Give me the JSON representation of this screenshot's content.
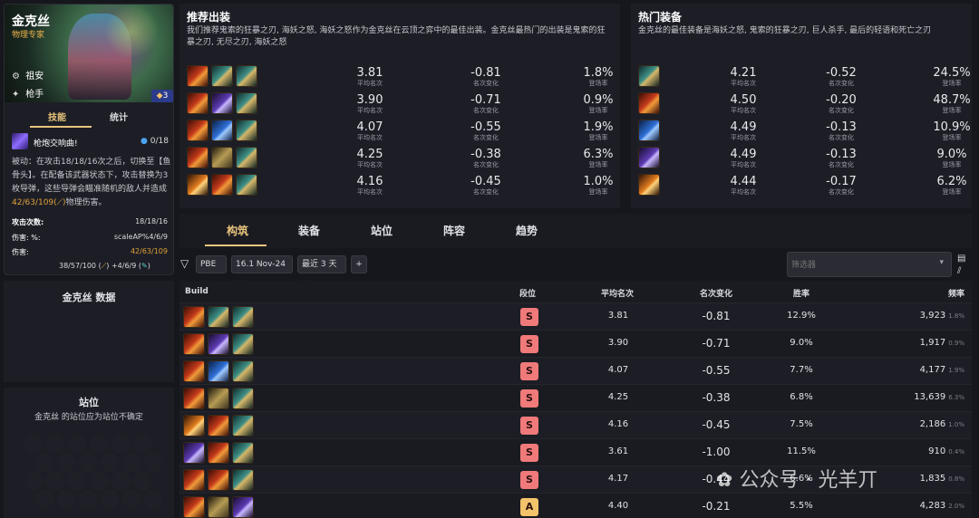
{
  "champion": {
    "name": "金克丝",
    "role": "物理专家",
    "traits": [
      {
        "icon": "rebel-icon",
        "label": "祖安"
      },
      {
        "icon": "sniper-icon",
        "label": "枪手"
      }
    ],
    "cost_badge": "3",
    "tabs": [
      "技能",
      "统计"
    ],
    "ability_name": "枪炮交响曲!",
    "mana": "0/18",
    "desc_1": "被动：在攻击18/18/16次之后，切换至【鱼骨头】。在配备该武器状态下，攻击替换为3枚导弹，这些导弹会瞄准随机的敌人并造成",
    "desc_dmg": "42/63/109",
    "desc_2": "物理伤害。",
    "stats": [
      {
        "label": "攻击次数:",
        "value": "18/18/16"
      },
      {
        "label": "伤害: %:",
        "value": "scaleAP%4/6/9"
      },
      {
        "label": "伤害:",
        "value": "42/63/109"
      }
    ],
    "footer_stat_a": "38/57/100 (",
    "footer_stat_b": ") +4/6/9 (",
    "footer_stat_c": ")"
  },
  "data_section": {
    "title": "金克丝 数据"
  },
  "position_section": {
    "title": "站位",
    "desc": "金克丝 的站位应为站位不确定"
  },
  "recommended": {
    "title": "推荐出装",
    "desc": "我们推荐鬼索的狂暴之刃, 海妖之怒, 海妖之怒作为金克丝在云顶之弈中的最佳出装。金克丝最热门的出装是鬼索的狂暴之刃, 无尽之刃, 海妖之怒",
    "rows": [
      {
        "items": [
          "fire",
          "dagger",
          "dagger"
        ],
        "avg": "3.81",
        "change": "-0.81",
        "rate": "1.8%"
      },
      {
        "items": [
          "fire",
          "violet",
          "dagger"
        ],
        "avg": "3.90",
        "change": "-0.71",
        "rate": "0.9%"
      },
      {
        "items": [
          "fire",
          "wave",
          "dagger"
        ],
        "avg": "4.07",
        "change": "-0.55",
        "rate": "1.9%"
      },
      {
        "items": [
          "fire",
          "claw",
          "dagger"
        ],
        "avg": "4.25",
        "change": "-0.38",
        "rate": "6.3%"
      },
      {
        "items": [
          "orange",
          "fire",
          "dagger"
        ],
        "avg": "4.16",
        "change": "-0.45",
        "rate": "1.0%"
      }
    ],
    "avg_label": "平均名次",
    "change_label": "名次变化",
    "rate_label": "登场率"
  },
  "hot_items": {
    "title": "热门装备",
    "desc": "金克丝的最佳装备是海妖之怒, 鬼索的狂暴之刃, 巨人杀手, 最后的轻语和死亡之刃",
    "rows": [
      {
        "item": "dagger",
        "avg": "4.21",
        "change": "-0.52",
        "rate": "24.5%"
      },
      {
        "item": "fire",
        "avg": "4.50",
        "change": "-0.20",
        "rate": "48.7%"
      },
      {
        "item": "wave",
        "avg": "4.49",
        "change": "-0.13",
        "rate": "10.9%"
      },
      {
        "item": "violet",
        "avg": "4.49",
        "change": "-0.13",
        "rate": "9.0%"
      },
      {
        "item": "orange",
        "avg": "4.44",
        "change": "-0.17",
        "rate": "6.2%"
      }
    ]
  },
  "nav_tabs": [
    "构筑",
    "装备",
    "站位",
    "阵容",
    "趋势"
  ],
  "filters": {
    "mode": "PBE",
    "patch": "16.1 Nov-24",
    "range": "最近 3 天",
    "add": "+",
    "placeholder": "筛选器"
  },
  "table": {
    "headers": [
      "Build",
      "段位",
      "平均名次",
      "名次变化",
      "胜率",
      "频率"
    ],
    "rows": [
      {
        "items": [
          "fire",
          "dagger",
          "dagger"
        ],
        "tier": "S",
        "avg": "3.81",
        "change": "-0.81",
        "win": "12.9%",
        "freq": "3,923",
        "freq_pct": "1.8%"
      },
      {
        "items": [
          "fire",
          "violet",
          "dagger"
        ],
        "tier": "S",
        "avg": "3.90",
        "change": "-0.71",
        "win": "9.0%",
        "freq": "1,917",
        "freq_pct": "0.9%"
      },
      {
        "items": [
          "fire",
          "wave",
          "dagger"
        ],
        "tier": "S",
        "avg": "4.07",
        "change": "-0.55",
        "win": "7.7%",
        "freq": "4,177",
        "freq_pct": "1.9%"
      },
      {
        "items": [
          "fire",
          "claw",
          "dagger"
        ],
        "tier": "S",
        "avg": "4.25",
        "change": "-0.38",
        "win": "6.8%",
        "freq": "13,639",
        "freq_pct": "6.3%"
      },
      {
        "items": [
          "orange",
          "fire",
          "dagger"
        ],
        "tier": "S",
        "avg": "4.16",
        "change": "-0.45",
        "win": "7.5%",
        "freq": "2,186",
        "freq_pct": "1.0%"
      },
      {
        "items": [
          "violet",
          "fire",
          "dagger"
        ],
        "tier": "S",
        "avg": "3.61",
        "change": "-1.00",
        "win": "11.5%",
        "freq": "910",
        "freq_pct": "0.4%"
      },
      {
        "items": [
          "fire",
          "fire",
          "dagger"
        ],
        "tier": "S",
        "avg": "4.17",
        "change": "-0.44",
        "win": "6.6%",
        "freq": "1,835",
        "freq_pct": "0.8%"
      },
      {
        "items": [
          "fire",
          "claw",
          "violet"
        ],
        "tier": "A",
        "avg": "4.40",
        "change": "-0.21",
        "win": "5.5%",
        "freq": "4,283",
        "freq_pct": "2.0%"
      }
    ]
  },
  "watermark": "公众号 · 光羊丌"
}
